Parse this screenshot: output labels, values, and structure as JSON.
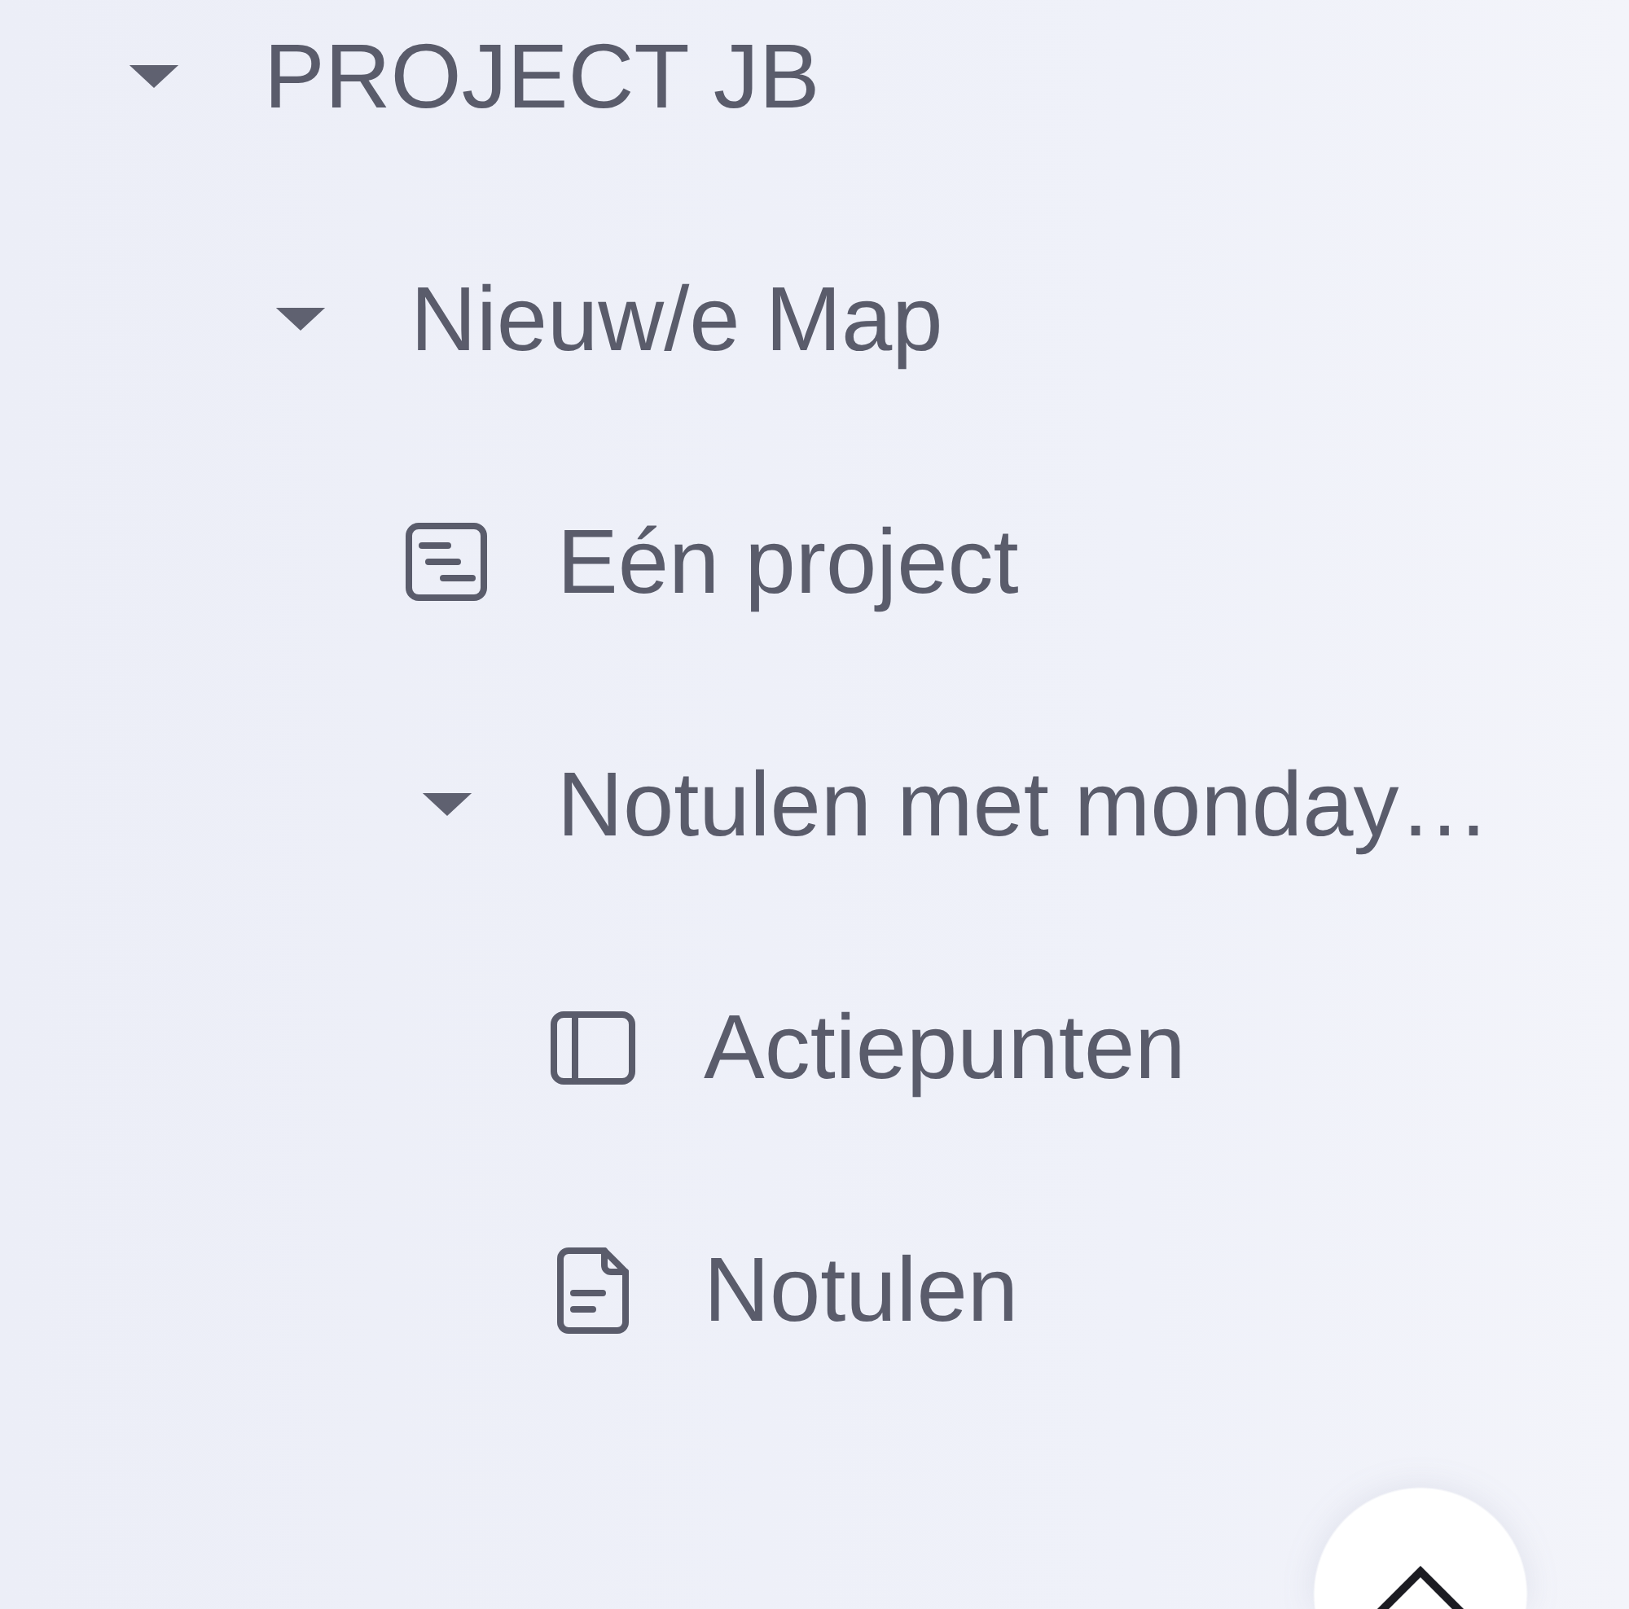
{
  "tree": [
    {
      "label": "PROJECT JB",
      "kind": "folder",
      "expanded": true,
      "children": [
        {
          "label": "Nieuw/e Map",
          "kind": "folder",
          "expanded": true,
          "children": [
            {
              "label": "Eén project",
              "kind": "board"
            },
            {
              "label": "Notulen met monday…",
              "kind": "folder",
              "expanded": true,
              "children": [
                {
                  "label": "Actiepunten",
                  "kind": "panel"
                },
                {
                  "label": "Notulen",
                  "kind": "doc"
                }
              ]
            }
          ]
        }
      ]
    }
  ]
}
